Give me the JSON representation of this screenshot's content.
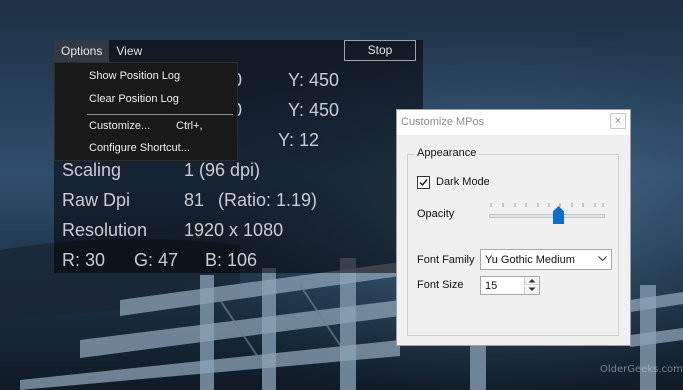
{
  "menu": {
    "options_label": "Options",
    "view_label": "View"
  },
  "stop_label": "Stop",
  "readouts": {
    "row1_y": "Y: 450",
    "row1_x_partial": "0",
    "row2_y": "Y: 450",
    "row2_x_partial": "0",
    "row3_y": "Y: 12",
    "scaling_label": "Scaling",
    "scaling_value": "1 (96 dpi)",
    "rawdpi_label": "Raw Dpi",
    "rawdpi_value": "81",
    "rawdpi_ratio": "(Ratio: 1.19)",
    "resolution_label": "Resolution",
    "resolution_value": "1920 x 1080",
    "r_value": "R: 30",
    "g_value": "G: 47",
    "b_value": "B: 106"
  },
  "options_menu": {
    "show_position_log": "Show Position Log",
    "clear_position_log": "Clear Position Log",
    "customize": "Customize...",
    "customize_shortcut": "Ctrl+,",
    "configure_shortcut": "Configure Shortcut..."
  },
  "dialog": {
    "title": "Customize MPos",
    "close_glyph": "×",
    "group_label": "Appearance",
    "dark_mode_label": "Dark Mode",
    "dark_mode_checked": true,
    "opacity_label": "Opacity",
    "opacity_level": 0.6,
    "font_family_label": "Font Family",
    "font_family_value": "Yu Gothic Medium",
    "font_size_label": "Font Size",
    "font_size_value": "15"
  },
  "watermark": "OlderGeeks.com",
  "colors": {
    "accent": "#0a6fd1",
    "overlay_text": "#c9cdd2",
    "menu_bg": "#191919"
  }
}
